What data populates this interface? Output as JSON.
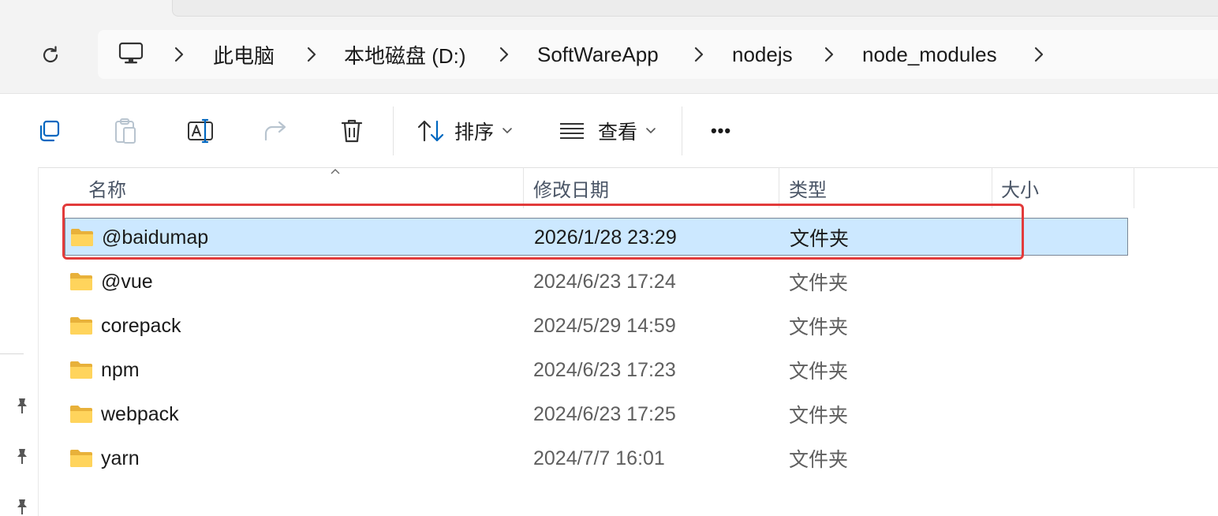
{
  "breadcrumb": {
    "items": [
      "此电脑",
      "本地磁盘 (D:)",
      "SoftWareApp",
      "nodejs",
      "node_modules"
    ]
  },
  "toolbar": {
    "sort_label": "排序",
    "view_label": "查看",
    "more_label": "•••"
  },
  "columns": {
    "name": "名称",
    "modified": "修改日期",
    "type": "类型",
    "size": "大小"
  },
  "files": [
    {
      "name": "@baidumap",
      "modified": "2026/1/28 23:29",
      "type": "文件夹",
      "selected": true
    },
    {
      "name": "@vue",
      "modified": "2024/6/23 17:24",
      "type": "文件夹"
    },
    {
      "name": "corepack",
      "modified": "2024/5/29 14:59",
      "type": "文件夹"
    },
    {
      "name": "npm",
      "modified": "2024/6/23 17:23",
      "type": "文件夹"
    },
    {
      "name": "webpack",
      "modified": "2024/6/23 17:25",
      "type": "文件夹"
    },
    {
      "name": "yarn",
      "modified": "2024/7/7 16:01",
      "type": "文件夹"
    }
  ],
  "colors": {
    "selection": "#cce8ff",
    "highlight_box": "#e23b3b",
    "accent": "#0067c0"
  }
}
